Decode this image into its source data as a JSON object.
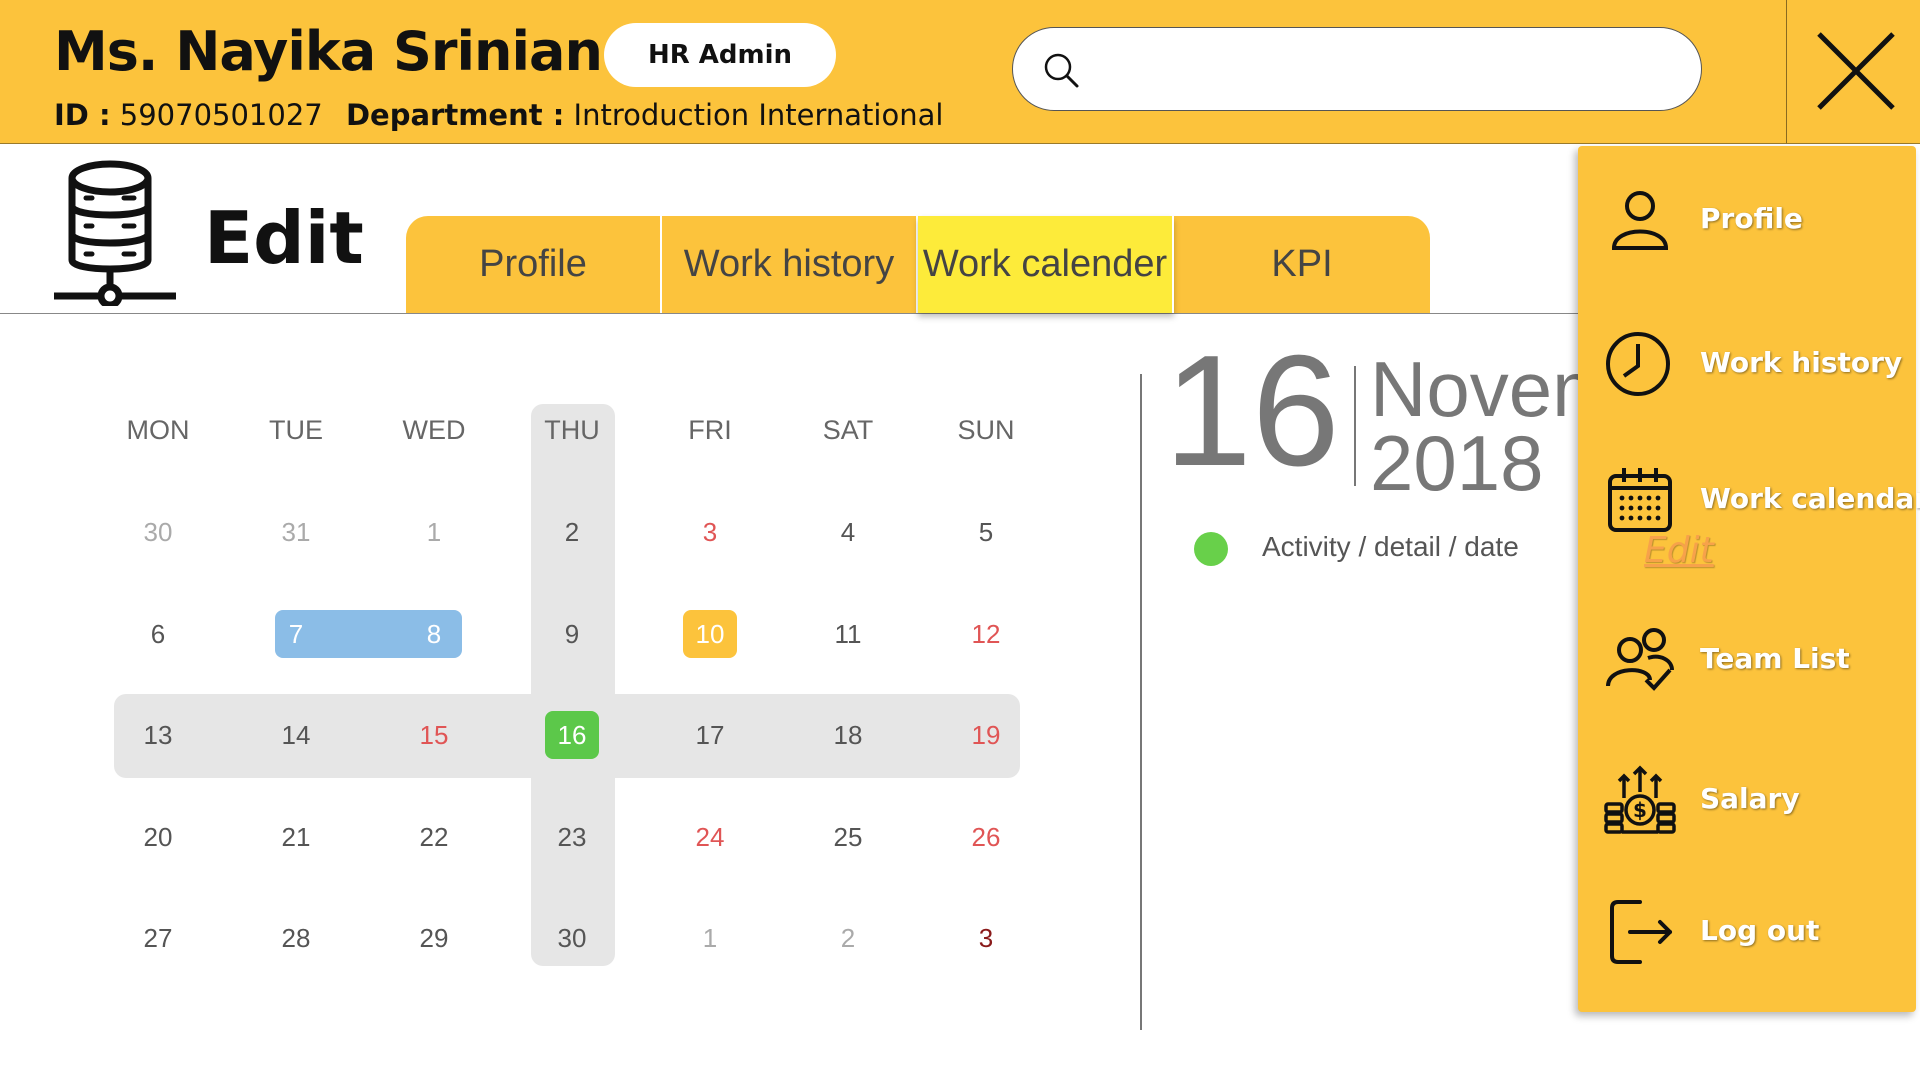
{
  "header": {
    "name": "Ms. Nayika Srinian",
    "role": "HR Admin",
    "id_label": "ID :",
    "id_value": "59070501027",
    "dept_label": "Department :",
    "dept_value": "Introduction International",
    "search_placeholder": ""
  },
  "page": {
    "title": "Edit"
  },
  "tabs": [
    {
      "label": "Profile",
      "active": false
    },
    {
      "label": "Work history",
      "active": false
    },
    {
      "label": "Work calender",
      "active": true
    },
    {
      "label": "KPI",
      "active": false
    }
  ],
  "calendar": {
    "weekdays": [
      "MON",
      "TUE",
      "WED",
      "THU",
      "FRI",
      "SAT",
      "SUN"
    ],
    "weeks": [
      [
        {
          "d": "30",
          "s": "muted"
        },
        {
          "d": "31",
          "s": "muted"
        },
        {
          "d": "1",
          "s": "muted"
        },
        {
          "d": "2",
          "s": ""
        },
        {
          "d": "3",
          "s": "holiday"
        },
        {
          "d": "4",
          "s": ""
        },
        {
          "d": "5",
          "s": ""
        }
      ],
      [
        {
          "d": "6",
          "s": ""
        },
        {
          "d": "7",
          "s": "range"
        },
        {
          "d": "8",
          "s": "range"
        },
        {
          "d": "9",
          "s": ""
        },
        {
          "d": "10",
          "s": "event"
        },
        {
          "d": "11",
          "s": ""
        },
        {
          "d": "12",
          "s": "holiday"
        }
      ],
      [
        {
          "d": "13",
          "s": ""
        },
        {
          "d": "14",
          "s": ""
        },
        {
          "d": "15",
          "s": "holiday"
        },
        {
          "d": "16",
          "s": "today"
        },
        {
          "d": "17",
          "s": ""
        },
        {
          "d": "18",
          "s": ""
        },
        {
          "d": "19",
          "s": "holiday"
        }
      ],
      [
        {
          "d": "20",
          "s": ""
        },
        {
          "d": "21",
          "s": ""
        },
        {
          "d": "22",
          "s": ""
        },
        {
          "d": "23",
          "s": ""
        },
        {
          "d": "24",
          "s": "holiday"
        },
        {
          "d": "25",
          "s": ""
        },
        {
          "d": "26",
          "s": "holiday"
        }
      ],
      [
        {
          "d": "27",
          "s": ""
        },
        {
          "d": "28",
          "s": ""
        },
        {
          "d": "29",
          "s": ""
        },
        {
          "d": "30",
          "s": ""
        },
        {
          "d": "1",
          "s": "muted"
        },
        {
          "d": "2",
          "s": "muted"
        },
        {
          "d": "3",
          "s": "holiday-dark"
        }
      ]
    ]
  },
  "selected_date": {
    "day": "16",
    "month": "November",
    "year": "2018",
    "activity": "Activity / detail / date"
  },
  "menu": {
    "items": [
      {
        "label": "Profile",
        "icon": "user-icon"
      },
      {
        "label": "Work history",
        "icon": "clock-icon"
      },
      {
        "label": "Work calendar",
        "icon": "calendar-icon"
      },
      {
        "label": "Team List",
        "icon": "team-icon"
      },
      {
        "label": "Salary",
        "icon": "salary-icon"
      },
      {
        "label": "Log out",
        "icon": "logout-icon"
      }
    ],
    "edit_label": "Edit"
  },
  "colors": {
    "accent": "#fcc33c",
    "active_tab": "#fdeb3a",
    "today": "#5cc84a",
    "range": "#8bbde7",
    "holiday": "#e05555"
  }
}
